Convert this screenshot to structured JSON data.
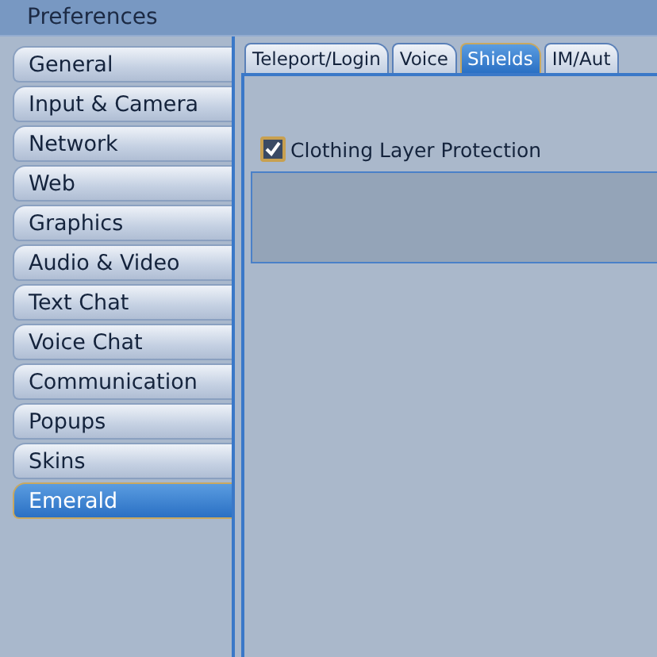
{
  "window": {
    "title": "Preferences"
  },
  "sidebar": {
    "items": [
      {
        "label": "General",
        "selected": false
      },
      {
        "label": "Input & Camera",
        "selected": false
      },
      {
        "label": "Network",
        "selected": false
      },
      {
        "label": "Web",
        "selected": false
      },
      {
        "label": "Graphics",
        "selected": false
      },
      {
        "label": "Audio & Video",
        "selected": false
      },
      {
        "label": "Text Chat",
        "selected": false
      },
      {
        "label": "Voice Chat",
        "selected": false
      },
      {
        "label": "Communication",
        "selected": false
      },
      {
        "label": "Popups",
        "selected": false
      },
      {
        "label": "Skins",
        "selected": false
      },
      {
        "label": "Emerald",
        "selected": true
      }
    ]
  },
  "tabs": [
    {
      "label": "Teleport/Login",
      "selected": false
    },
    {
      "label": "Voice",
      "selected": false
    },
    {
      "label": "Shields",
      "selected": true
    },
    {
      "label": "IM/Aut",
      "selected": false
    }
  ],
  "options": [
    {
      "label": "Clothing Layer Protection",
      "checked": true
    }
  ]
}
